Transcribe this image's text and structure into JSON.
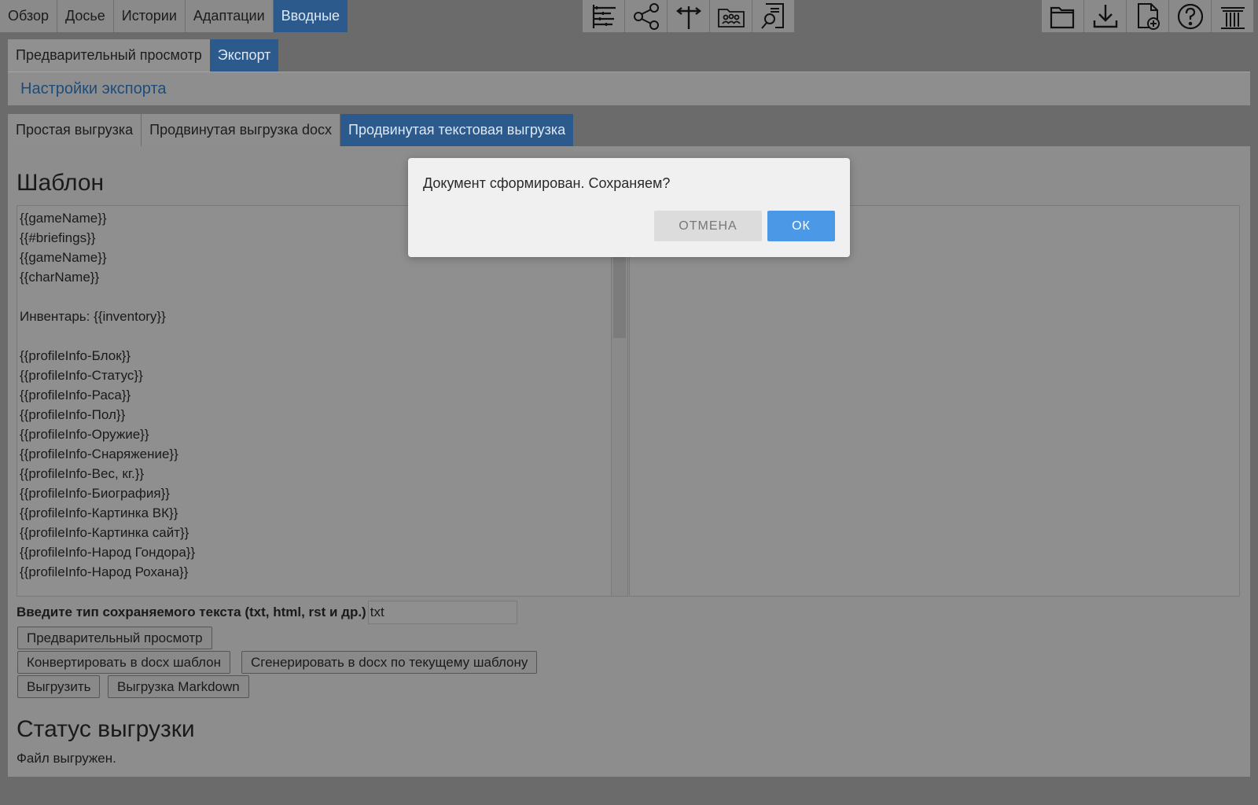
{
  "main_tabs": [
    "Обзор",
    "Досье",
    "Истории",
    "Адаптации",
    "Вводные"
  ],
  "center_icons": [
    "timeline-icon",
    "share-graph-icon",
    "crossroads-icon",
    "group-folder-icon",
    "document-search-icon"
  ],
  "right_icons": [
    "open-folder-icon",
    "download-icon",
    "new-file-icon",
    "help-icon",
    "settings-pillar-icon"
  ],
  "sub_tabs": [
    "Предварительный просмотр",
    "Экспорт"
  ],
  "settings_header": "Настройки экспорта",
  "export_tabs": [
    "Простая выгрузка",
    "Продвинутая выгрузка docx",
    "Продвинутая текстовая выгрузка"
  ],
  "template": {
    "heading": "Шаблон",
    "lines": [
      "{{gameName}}",
      "{{#briefings}}",
      "{{gameName}}",
      "{{charName}}",
      "",
      "Инвентарь: {{inventory}}",
      "",
      "{{profileInfo-Блок}}",
      "{{profileInfo-Статус}}",
      "{{profileInfo-Раса}}",
      "{{profileInfo-Пол}}",
      "{{profileInfo-Оружие}}",
      "{{profileInfo-Снаряжение}}",
      "{{profileInfo-Вес, кг.}}",
      "{{profileInfo-Биография}}",
      "{{profileInfo-Картинка ВК}}",
      "{{profileInfo-Картинка сайт}}",
      "{{profileInfo-Народ Гондора}}",
      "{{profileInfo-Народ Рохана}}"
    ]
  },
  "file_type": {
    "label": "Введите тип сохраняемого текста (txt, html, rst и др.)",
    "value": "txt"
  },
  "buttons": {
    "preview": "Предварительный просмотр",
    "convert_docx": "Конвертировать в docx шаблон",
    "generate_docx": "Сгенерировать в docx по текущему шаблону",
    "export": "Выгрузить",
    "export_markdown": "Выгрузка Markdown"
  },
  "status": {
    "heading": "Статус выгрузки",
    "text": "Файл выгружен."
  },
  "dialog": {
    "message": "Документ сформирован. Сохраняем?",
    "cancel": "ОТМЕНА",
    "ok": "ОК"
  },
  "colors": {
    "active_tab": "#2c5a8c",
    "ok_button": "#4a98e6",
    "header_text": "#1e4c7a"
  }
}
